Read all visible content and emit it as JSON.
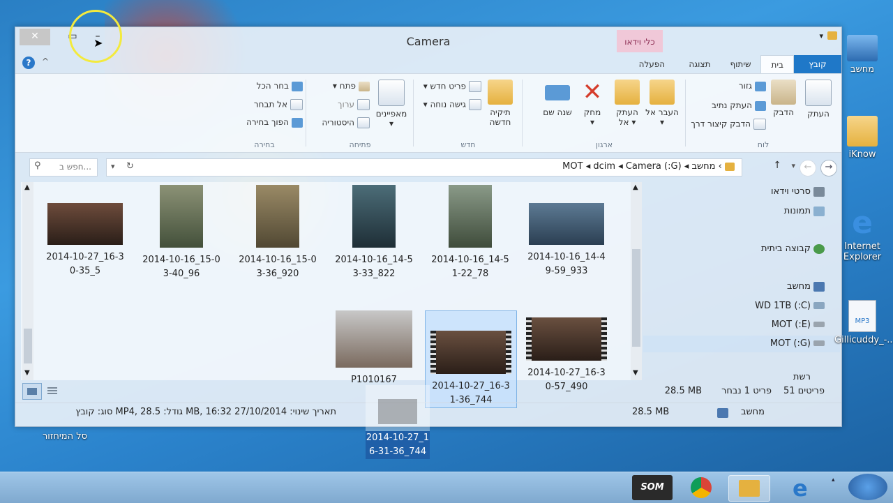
{
  "window": {
    "title": "Camera",
    "contextual_tab": "כלי וידאו",
    "tabs": [
      "קובץ",
      "בית",
      "שיתוף",
      "תצוגה",
      "הפעלה"
    ]
  },
  "ribbon": {
    "clipboard": {
      "label": "לוח",
      "copy": "העתק",
      "paste": "הדבק",
      "cut": "גזור",
      "copy_path": "העתק נתיב",
      "paste_shortcut": "הדבק קיצור דרך"
    },
    "organize": {
      "label": "ארגון",
      "move_to": "העבר אל",
      "copy_to": "העתק אל",
      "delete": "מחק",
      "rename": "שנה שם"
    },
    "new": {
      "label": "חדש",
      "new_folder": "תיקיה חדשה",
      "new_item": "פריט חדש",
      "easy_access": "גישה נוחה"
    },
    "open": {
      "label": "פתיחה",
      "properties": "מאפיינים",
      "open": "פתח",
      "edit": "ערוך",
      "history": "היסטוריה"
    },
    "select": {
      "label": "בחירה",
      "select_all": "בחר הכל",
      "select_none": "אל תבחר",
      "invert": "הפוך בחירה"
    }
  },
  "address": {
    "crumbs": [
      "מחשב",
      "(G:) MOT",
      "dcim",
      "Camera"
    ],
    "search_placeholder": "חפש ב..."
  },
  "files": [
    {
      "name": "2014-10-16_14-49-59_933",
      "line1": "2014-10-16_14-4",
      "line2": "9-59_933",
      "kind": "photo"
    },
    {
      "name": "2014-10-16_14-51-22_78",
      "line1": "2014-10-16_14-5",
      "line2": "1-22_78",
      "kind": "photo"
    },
    {
      "name": "2014-10-16_14-53-33_822",
      "line1": "2014-10-16_14-5",
      "line2": "3-33_822",
      "kind": "photo"
    },
    {
      "name": "2014-10-16_15-03-36_920",
      "line1": "2014-10-16_15-0",
      "line2": "3-36_920",
      "kind": "photo"
    },
    {
      "name": "2014-10-16_15-03-40_96",
      "line1": "2014-10-16_15-0",
      "line2": "3-40_96",
      "kind": "photo"
    },
    {
      "name": "2014-10-27_16-30-35_5",
      "line1": "2014-10-27_16-3",
      "line2": "0-35_5",
      "kind": "photo"
    },
    {
      "name": "2014-10-27_16-30-57_490",
      "line1": "2014-10-27_16-3",
      "line2": "0-57_490",
      "kind": "video"
    },
    {
      "name": "2014-10-27_16-31-36_744",
      "line1": "2014-10-27_16-3",
      "line2": "1-36_744",
      "kind": "video"
    },
    {
      "name": "P1010167",
      "line1": "P1010167",
      "line2": "",
      "kind": "photo"
    }
  ],
  "nav": {
    "videos": "סרטי וידאו",
    "pictures": "תמונות",
    "homegroup": "קבוצה ביתית",
    "computer": "מחשב",
    "drive_c": "(C:) WD 1TB",
    "drive_e": "(E:) MOT",
    "drive_g": "(G:) MOT",
    "network": "רשת"
  },
  "status": {
    "item_count": "51 פריטים",
    "selected": "פריט 1 נבחר",
    "selected_size": "28.5 MB",
    "details": "סוג: קובץ MP4, גודל: 28.5 MB, תאריך שינוי: 27/10/2014 16:32",
    "size": "28.5 MB",
    "location": "מחשב"
  },
  "desktop": {
    "computer": "מחשב",
    "iknow": "iKnow",
    "ie_line1": "Internet",
    "ie_line2": "Explorer",
    "mp3": "Gillicuddy_-...",
    "recycle": "סל המיחזור",
    "drag_line1": "2014-10-27_1",
    "drag_line2": "6-31-36_744"
  },
  "taskbar": {
    "som": "SOM"
  },
  "colors": {
    "file_tab": "#1f78c8",
    "selection": "#c4e0fc",
    "context_tab": "#f0c8d8"
  }
}
